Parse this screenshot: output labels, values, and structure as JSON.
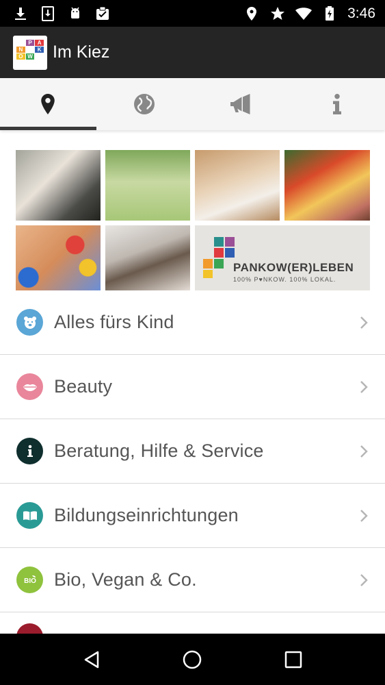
{
  "status_bar": {
    "time": "3:46",
    "left_icons": [
      "download-icon",
      "download-box-icon",
      "android-icon",
      "clipboard-check-icon"
    ],
    "right_icons": [
      "location-icon",
      "star-icon",
      "wifi-icon",
      "battery-charging-icon"
    ]
  },
  "app_bar": {
    "title": "Im Kiez",
    "logo_letters": [
      "P",
      "A",
      "N",
      "K",
      "O",
      "W"
    ]
  },
  "tabs": [
    {
      "icon": "location-pin-icon",
      "active": true
    },
    {
      "icon": "globe-icon",
      "active": false
    },
    {
      "icon": "megaphone-icon",
      "active": false
    },
    {
      "icon": "info-icon",
      "active": false
    }
  ],
  "banner": {
    "brand": "PANKOW(ER)LEBEN",
    "tagline": "100% P♥NKOW. 100% LOKAL."
  },
  "categories": [
    {
      "label": "Alles fürs Kind",
      "icon": "teddy-bear-icon",
      "color": "#5aa6d6"
    },
    {
      "label": "Beauty",
      "icon": "lips-icon",
      "color": "#e9869b"
    },
    {
      "label": "Beratung, Hilfe & Service",
      "icon": "info-icon",
      "color": "#0f2e2e"
    },
    {
      "label": "Bildungseinrichtungen",
      "icon": "book-icon",
      "color": "#2a9a95"
    },
    {
      "label": "Bio, Vegan & Co.",
      "icon": "bio-icon",
      "color": "#8fc23d"
    }
  ],
  "partial_item_color": "#9b1c2c",
  "nav": [
    "back-icon",
    "home-icon",
    "recents-icon"
  ]
}
